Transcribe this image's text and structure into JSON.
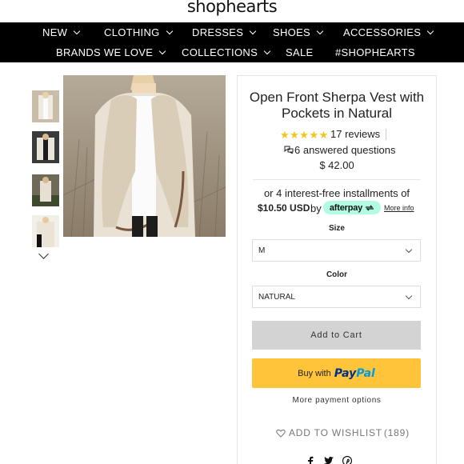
{
  "header": {
    "logo": "shophearts"
  },
  "nav": {
    "row1": [
      {
        "label": "NEW",
        "dropdown": true
      },
      {
        "label": "CLOTHING",
        "dropdown": true
      },
      {
        "label": "DRESSES",
        "dropdown": true
      },
      {
        "label": "SHOES",
        "dropdown": true
      },
      {
        "label": "ACCESSORIES",
        "dropdown": true
      }
    ],
    "row2": [
      {
        "label": "BRANDS WE LOVE",
        "dropdown": true
      },
      {
        "label": "COLLECTIONS",
        "dropdown": true
      },
      {
        "label": "SALE",
        "dropdown": false
      },
      {
        "label": "#SHOPHEARTS",
        "dropdown": false
      }
    ]
  },
  "gallery": {
    "thumbnails": [
      "thumbnail-1",
      "thumbnail-2",
      "thumbnail-3",
      "thumbnail-4"
    ],
    "more_icon": "chevron-down-icon"
  },
  "product": {
    "title": "Open Front Sherpa Vest with Pockets in Natural",
    "rating_stars": "★★★★★",
    "reviews": "17 reviews",
    "questions": "6 answered questions",
    "price": "$ 42.00"
  },
  "afterpay": {
    "line1": "or 4 interest-free installments of",
    "amount": "$10.50 USD",
    "by": "by",
    "brand": "afterpay",
    "more_info": "More info"
  },
  "options": {
    "size_label": "Size",
    "size_value": "M",
    "color_label": "Color",
    "color_value": "NATURAL"
  },
  "actions": {
    "add_to_cart": "Add to Cart",
    "paypal_prefix": "Buy with",
    "paypal_pay": "Pay",
    "paypal_pal": "Pal",
    "more_payment": "More payment options",
    "wishlist": "ADD TO WISHLIST",
    "wishlist_count": "(189)"
  },
  "colors": {
    "nav_bg": "#000000",
    "star": "#f5c518",
    "afterpay_mint": "#b2fce4",
    "paypal_yellow": "#ffc439",
    "add_cart_gray": "#d3d3d3"
  }
}
